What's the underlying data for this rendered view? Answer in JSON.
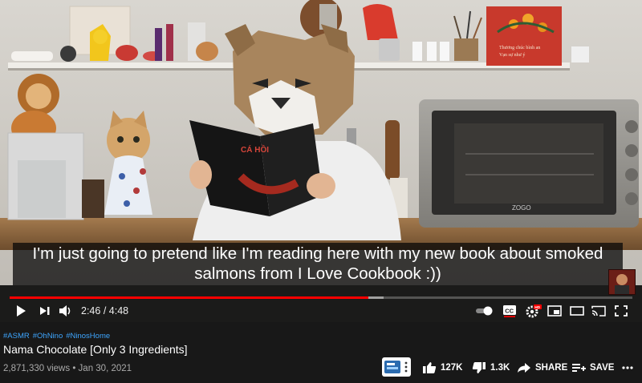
{
  "video": {
    "subtitle": [
      "I'm just going to pretend like I'm reading here with my new book about smoked",
      "salmons from I Love Cookbook :))"
    ],
    "current_time": "2:46",
    "separator": " / ",
    "duration": "4:48",
    "progress_played": 0.576,
    "progress_buffered": 0.6,
    "scene": {
      "book_title": "CÁ HỒI",
      "poster_text": [
        "Thương chúc bình an",
        "Vạn sự như ý"
      ],
      "oven_brand": "ZOGO"
    }
  },
  "controls": {
    "play_icon": "play-icon",
    "next_icon": "next-icon",
    "volume_icon": "volume-icon",
    "autoplay_icon": "autoplay-toggle-icon",
    "cc_label": "CC",
    "settings_badge": "HD",
    "miniplayer_icon": "miniplayer-icon",
    "theater_icon": "theater-icon",
    "cast_icon": "cast-icon",
    "fullscreen_icon": "fullscreen-icon"
  },
  "info": {
    "hashtags": [
      "#ASMR",
      "#OhNino",
      "#NinosHome"
    ],
    "title": "Nama Chocolate [Only 3 Ingredients]",
    "views": "2,871,330 views",
    "dot": " • ",
    "date": "Jan 30, 2021"
  },
  "actions": {
    "likes": "127K",
    "dislikes": "1.3K",
    "share": "SHARE",
    "save": "SAVE"
  },
  "colors": {
    "accent": "#ff0000",
    "link": "#3ea6ff",
    "background": "#181818"
  }
}
